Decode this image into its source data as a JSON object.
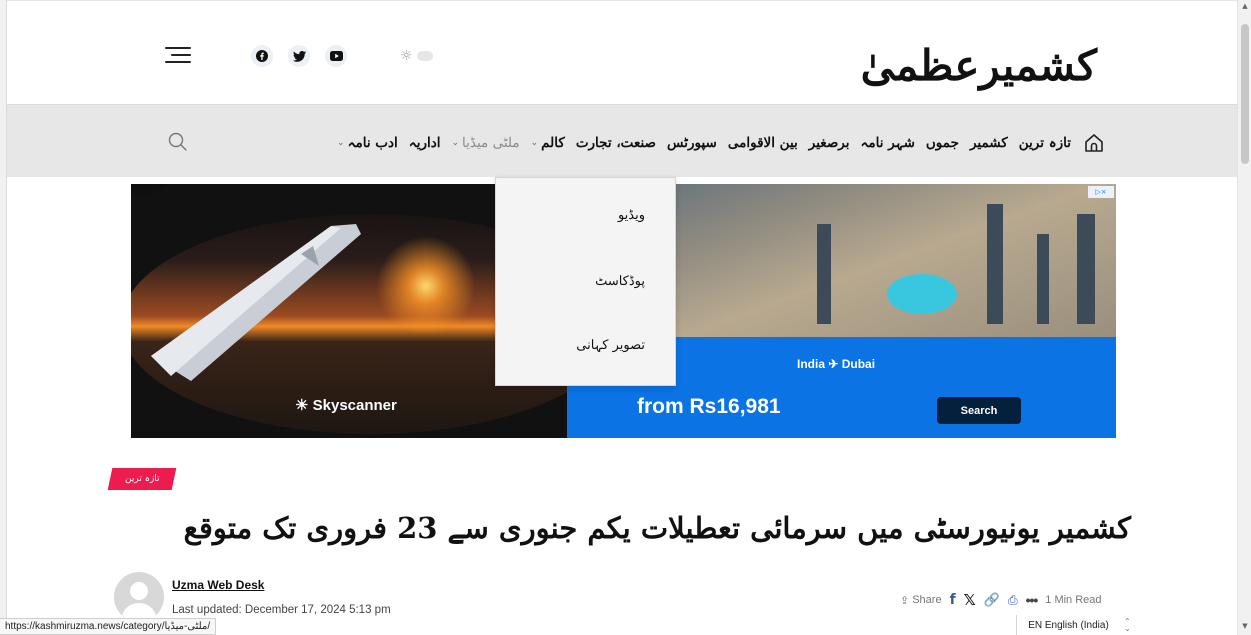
{
  "header": {
    "logo_text": "کشمیرعظمیٰ",
    "menu_icon": "hamburger-icon",
    "social": [
      {
        "name": "facebook",
        "icon": "facebook-icon",
        "color": "#111111"
      },
      {
        "name": "twitter",
        "icon": "twitter-icon",
        "color": "#111111"
      },
      {
        "name": "youtube",
        "icon": "youtube-icon",
        "color": "#111111"
      }
    ],
    "theme_toggle_icon": "sun-icon",
    "theme_toggle_glyph": "☼"
  },
  "nav": {
    "search_icon": "search-icon",
    "home_icon": "home-icon",
    "items": [
      {
        "label": "تازہ ترین",
        "has_dropdown": false
      },
      {
        "label": "کشمیر",
        "has_dropdown": false
      },
      {
        "label": "جموں",
        "has_dropdown": false
      },
      {
        "label": "شہر نامہ",
        "has_dropdown": false
      },
      {
        "label": "برصغیر",
        "has_dropdown": false
      },
      {
        "label": "بین الاقوامی",
        "has_dropdown": false
      },
      {
        "label": "سپورٹس",
        "has_dropdown": false
      },
      {
        "label": "صنعت، تجارت",
        "has_dropdown": false
      },
      {
        "label": "کالم",
        "has_dropdown": true
      },
      {
        "label": "ملٹی میڈیا",
        "has_dropdown": true,
        "active": true
      },
      {
        "label": "اداریہ",
        "has_dropdown": false
      },
      {
        "label": "ادب نامہ",
        "has_dropdown": true
      }
    ],
    "chevron_glyph": "⌄"
  },
  "dropdown": {
    "items": [
      "ویڈیو",
      "پوڈکاسٹ",
      "تصویر کہانی"
    ]
  },
  "ad": {
    "brand": "Skyscanner",
    "route": "India ✈ Dubai",
    "price": "from Rs16,981",
    "button_label": "Search",
    "adchoices_label": "▷×",
    "colors": {
      "panel": "#0b73e3",
      "button": "#05203c"
    }
  },
  "article": {
    "category": "تازہ ترین",
    "category_color": "#ed1c4f",
    "headline": "کشمیر یونیورسٹی میں سرمائی تعطیلات یکم جنوری سے 23 فروری تک متوقع",
    "author": "Uzma Web Desk",
    "last_updated": "Last updated: December 17, 2024 5:13 pm",
    "share_label": "Share",
    "share_icons": [
      "share-icon",
      "facebook-icon",
      "x-icon",
      "link-icon",
      "print-icon",
      "more-icon"
    ],
    "share_glyphs": {
      "share": "⇪",
      "facebook": "f",
      "x": "𝕏",
      "link": "🔗",
      "print": "⎙",
      "more": "•••"
    },
    "read_time": "1 Min Read"
  },
  "status_bar": {
    "url": "https://kashmiruzma.news/category/ملٹی-میڈیا/"
  },
  "language": {
    "label": "EN English (India)",
    "toggle_glyph": "⌃\n⌄"
  }
}
